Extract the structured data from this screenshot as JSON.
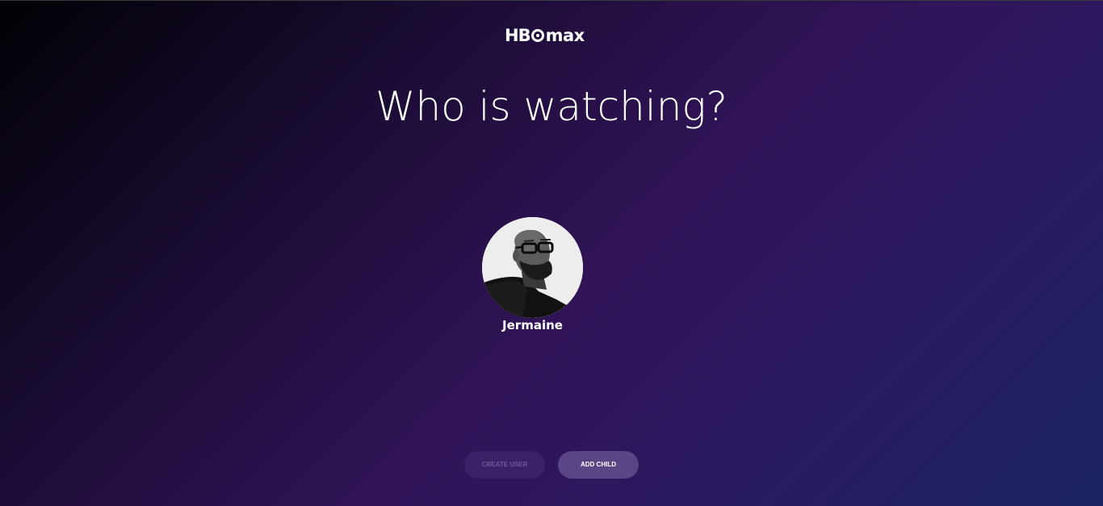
{
  "brand": {
    "logo_prefix": "HB",
    "logo_suffix": "max",
    "icon": "hbo-max-logo"
  },
  "title": "Who is watching?",
  "profiles": [
    {
      "name": "Jermaine",
      "avatar_icon": "user-avatar-photo"
    }
  ],
  "actions": {
    "create_user_label": "CREATE USER",
    "add_child_label": "ADD CHILD"
  },
  "colors": {
    "background_start": "#020105",
    "background_mid": "#311458",
    "background_end": "#1b2464",
    "button_disabled": "#3b2268",
    "button_active": "#5a4585"
  }
}
